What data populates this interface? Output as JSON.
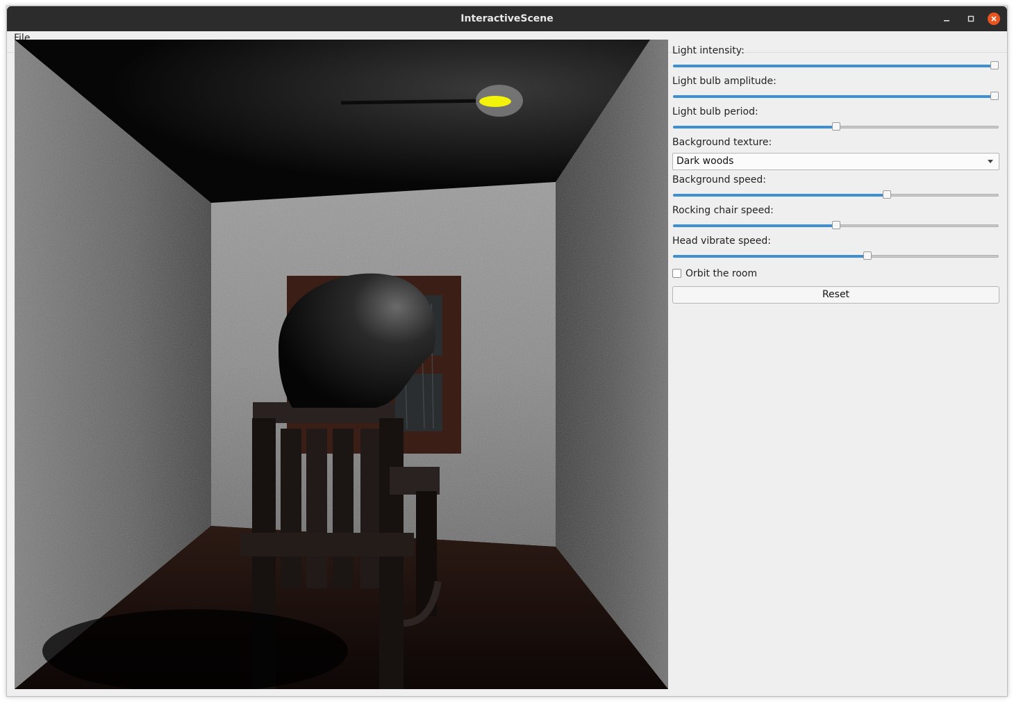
{
  "window": {
    "title": "InteractiveScene"
  },
  "menu": {
    "file_label": "File"
  },
  "controls": {
    "light_intensity": {
      "label": "Light intensity:",
      "value": 1.0
    },
    "bulb_amplitude": {
      "label": "Light bulb amplitude:",
      "value": 1.0
    },
    "bulb_period": {
      "label": "Light bulb period:",
      "value": 0.5
    },
    "background_texture": {
      "label": "Background texture:",
      "selected": "Dark woods"
    },
    "background_speed": {
      "label": "Background speed:",
      "value": 0.66
    },
    "rocking_chair_speed": {
      "label": "Rocking chair speed:",
      "value": 0.5
    },
    "head_vibrate_speed": {
      "label": "Head vibrate speed:",
      "value": 0.6
    },
    "orbit": {
      "label": "Orbit the room",
      "checked": false
    },
    "reset": {
      "label": "Reset"
    }
  },
  "colors": {
    "accent": "#3f8fd2",
    "titlebar": "#2c2c2c",
    "close": "#e95420",
    "bulb": "#f2f20a"
  }
}
